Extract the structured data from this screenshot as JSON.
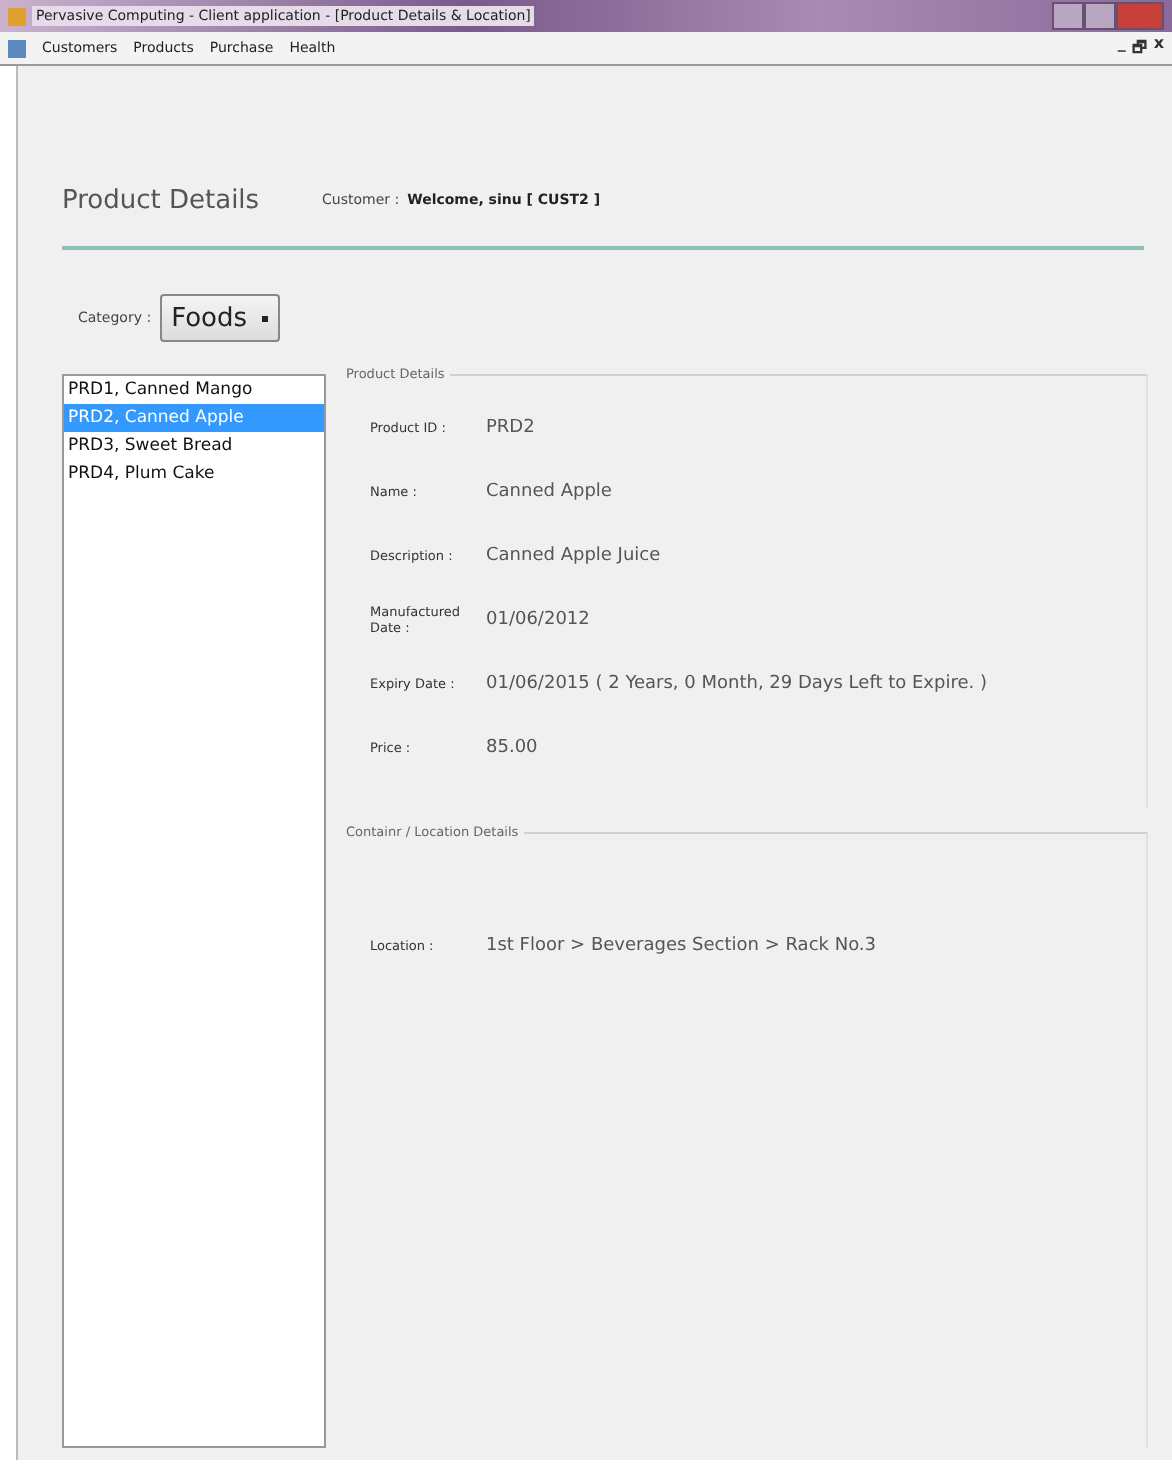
{
  "window": {
    "title": "Pervasive Computing - Client application - [Product Details & Location]"
  },
  "menu": [
    "Customers",
    "Products",
    "Purchase",
    "Health"
  ],
  "mdi_controls": [
    "_",
    "🗗",
    "x"
  ],
  "header": {
    "title": "Product Details",
    "customer_label": "Customer :",
    "customer_value": "Welcome, sinu [ CUST2 ]"
  },
  "category": {
    "label": "Category :",
    "value": "Foods"
  },
  "products": [
    {
      "label": "PRD1, Canned Mango",
      "selected": false
    },
    {
      "label": "PRD2, Canned Apple",
      "selected": true
    },
    {
      "label": "PRD3, Sweet Bread",
      "selected": false
    },
    {
      "label": "PRD4, Plum Cake",
      "selected": false
    }
  ],
  "product_details": {
    "title": "Product Details",
    "fields": [
      {
        "label": "Product ID :",
        "value": "PRD2"
      },
      {
        "label": "Name :",
        "value": "Canned Apple"
      },
      {
        "label": "Description :",
        "value": "Canned Apple Juice"
      },
      {
        "label": "Manufactured Date :",
        "value": "01/06/2012"
      },
      {
        "label": "Expiry Date :",
        "value": "01/06/2015 ( 2 Years, 0 Month, 29 Days Left to Expire. )"
      },
      {
        "label": "Price :",
        "value": "85.00"
      }
    ]
  },
  "location_details": {
    "title": "Containr / Location Details",
    "fields": [
      {
        "label": "Location :",
        "value": "1st Floor > Beverages Section > Rack No.3"
      }
    ]
  }
}
